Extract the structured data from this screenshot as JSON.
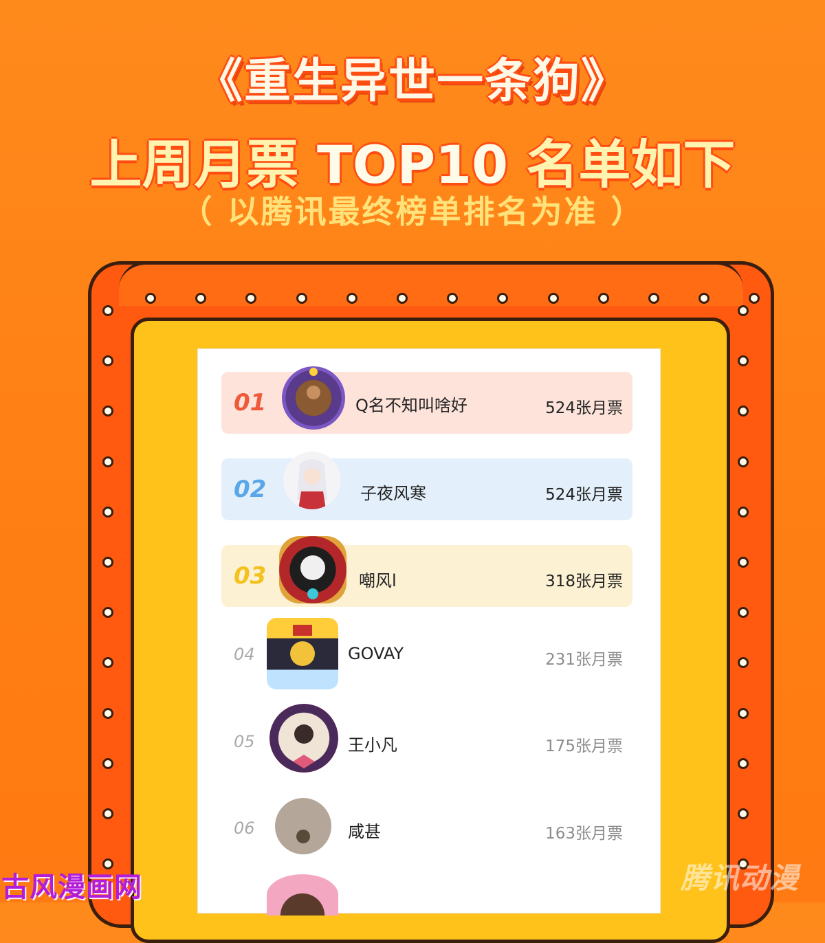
{
  "header": {
    "title_line1": "《重生异世一条狗》",
    "title_line2_pre": "上周月票 ",
    "title_line2_mid": "TOP10",
    "title_line2_post": " 名单如下",
    "subtitle": "（ 以腾讯最终榜单排名为准 ）"
  },
  "ranking": [
    {
      "rank": "01",
      "name": "Q名不知叫啥好",
      "votes": "524张月票",
      "avatar_icon": "avatar-icon"
    },
    {
      "rank": "02",
      "name": "子夜风寒",
      "votes": "524张月票",
      "avatar_icon": "avatar-icon"
    },
    {
      "rank": "03",
      "name": "嘲风l",
      "votes": "318张月票",
      "avatar_icon": "avatar-icon"
    },
    {
      "rank": "04",
      "name": "GOVAY",
      "votes": "231张月票",
      "avatar_icon": "avatar-icon"
    },
    {
      "rank": "05",
      "name": "王小凡",
      "votes": "175张月票",
      "avatar_icon": "avatar-icon"
    },
    {
      "rank": "06",
      "name": "咸甚",
      "votes": "163张月票",
      "avatar_icon": "avatar-icon"
    }
  ],
  "watermarks": {
    "left": "古风漫画网",
    "right": "腾讯动漫"
  },
  "colors": {
    "background": "#ff8a1c",
    "frame_outer": "#ff5a10",
    "frame_inner": "#ffc21a",
    "rank1_bg": "#fde3da",
    "rank2_bg": "#e3f0fb",
    "rank3_bg": "#fdf1d4",
    "rank1_color": "#ee5a3a",
    "rank2_color": "#5aa6e8",
    "rank3_color": "#f3c21e"
  }
}
